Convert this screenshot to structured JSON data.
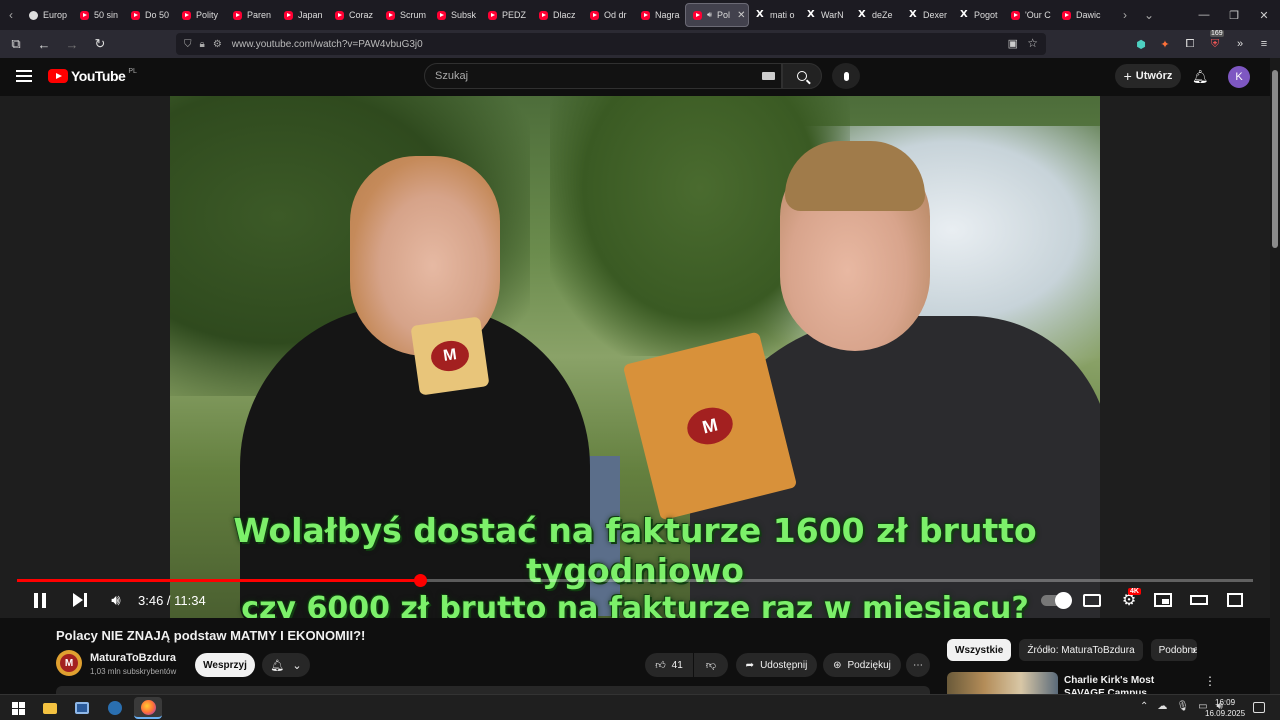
{
  "browser": {
    "tabs": [
      {
        "label": "Europ",
        "icon": "globe"
      },
      {
        "label": "50 sin",
        "icon": "youtube"
      },
      {
        "label": "Do 50",
        "icon": "youtube"
      },
      {
        "label": "Polity",
        "icon": "youtube"
      },
      {
        "label": "Paren",
        "icon": "youtube"
      },
      {
        "label": "Japan",
        "icon": "youtube"
      },
      {
        "label": "Coraz",
        "icon": "youtube"
      },
      {
        "label": "Scrum",
        "icon": "youtube"
      },
      {
        "label": "Subsk",
        "icon": "youtube"
      },
      {
        "label": "PEDZ",
        "icon": "youtube"
      },
      {
        "label": "Dlacz",
        "icon": "youtube"
      },
      {
        "label": "Od dr",
        "icon": "youtube"
      },
      {
        "label": "Nagra",
        "icon": "youtube"
      },
      {
        "label": "Pol",
        "icon": "youtube",
        "active": true
      },
      {
        "label": "mati o",
        "icon": "x"
      },
      {
        "label": "WarN",
        "icon": "x"
      },
      {
        "label": "deZe",
        "icon": "x"
      },
      {
        "label": "Dexer",
        "icon": "x"
      },
      {
        "label": "Pogot",
        "icon": "x"
      },
      {
        "label": "'Our C",
        "icon": "youtube"
      },
      {
        "label": "Dawic",
        "icon": "youtube"
      }
    ],
    "url": "www.youtube.com/watch?v=PAW4vbuG3j0",
    "extension_badge": "169"
  },
  "youtube": {
    "logo_text": "YouTube",
    "country_code": "PL",
    "search_placeholder": "Szukaj",
    "create_label": "Utwórz",
    "avatar_letter": "K"
  },
  "player": {
    "subtitle_line1": "Wolałbyś dostać na fakturze 1600 zł brutto tygodniowo",
    "subtitle_line2": "czy 6000 zł brutto na fakturze raz w miesiącu?",
    "current_time": "3:46",
    "duration": "11:34",
    "time_display": "3:46 / 11:34",
    "progress_fraction": 0.326,
    "quality_badge": "4K",
    "overlay_logo_letter": "M"
  },
  "video": {
    "title": "Polacy NIE ZNAJĄ podstaw MATMY I EKONOMII?!",
    "channel_name": "MaturaToBzdura",
    "subscribers": "1,03 mln subskrybentów",
    "support_label": "Wesprzyj",
    "likes": "41",
    "share_label": "Udostępnij",
    "thanks_label": "Podziękuj",
    "channel_logo_letter": "M"
  },
  "sidebar": {
    "chips": [
      "Wszystkie",
      "Źródło: MaturaToBzdura",
      "Podobne"
    ],
    "recommendation_title": "Charlie Kirk's Most SAVAGE Campus Moments of Spring"
  },
  "taskbar": {
    "time": "16:09",
    "date": "16.09.2025"
  },
  "colors": {
    "youtube_red": "#ff0000",
    "subtitle_green": "#7cf06a",
    "avatar_purple": "#7e57c2"
  }
}
